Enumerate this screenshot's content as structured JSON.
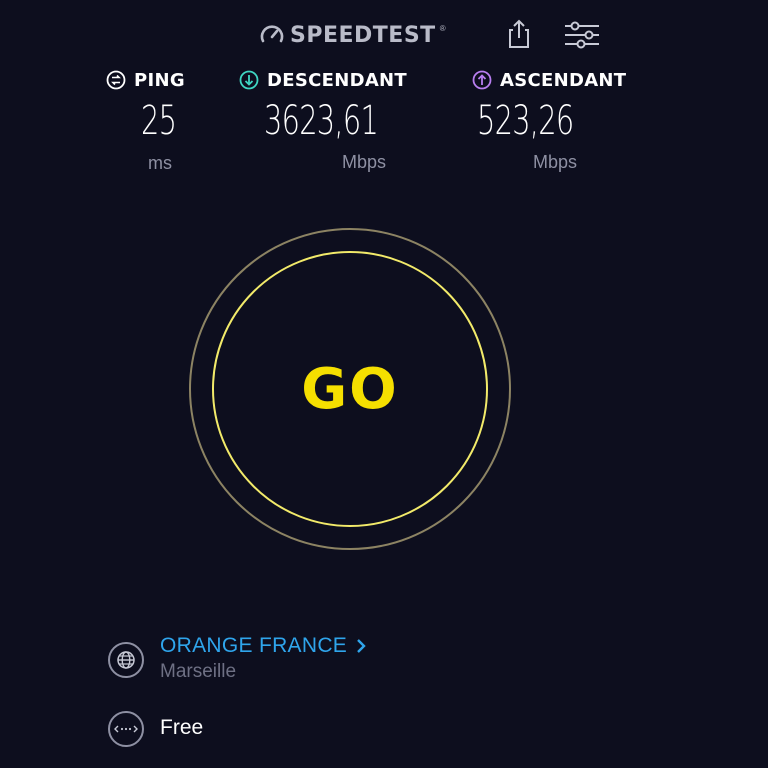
{
  "header": {
    "logo_text": "SPEEDTEST",
    "logo_mark": "®",
    "logo_icon": "speedometer-icon",
    "share_icon": "share-icon",
    "settings_icon": "sliders-icon"
  },
  "metrics": {
    "ping": {
      "label": "PING",
      "value": "25",
      "unit": "ms",
      "icon": "ping-icon"
    },
    "download": {
      "label": "DESCENDANT",
      "value": "3623,61",
      "unit": "Mbps",
      "icon": "download-arrow-icon",
      "color": "#3fd6c3"
    },
    "upload": {
      "label": "ASCENDANT",
      "value": "523,26",
      "unit": "Mbps",
      "icon": "upload-arrow-icon",
      "color": "#b87ef0"
    }
  },
  "go_button": {
    "label": "GO",
    "label_color": "#f5df00",
    "inner_ring_color": "#f2ea6a",
    "outer_ring_color": "#8c8363"
  },
  "provider": {
    "name": "ORANGE FRANCE",
    "location": "Marseille",
    "icon": "globe-icon",
    "chevron_icon": "chevron-right-icon",
    "color": "#2fa5ec"
  },
  "connection": {
    "name": "Free",
    "icon": "connection-dots-icon"
  },
  "colors": {
    "background": "#0d0e1e",
    "muted_text": "#8e90a3"
  }
}
